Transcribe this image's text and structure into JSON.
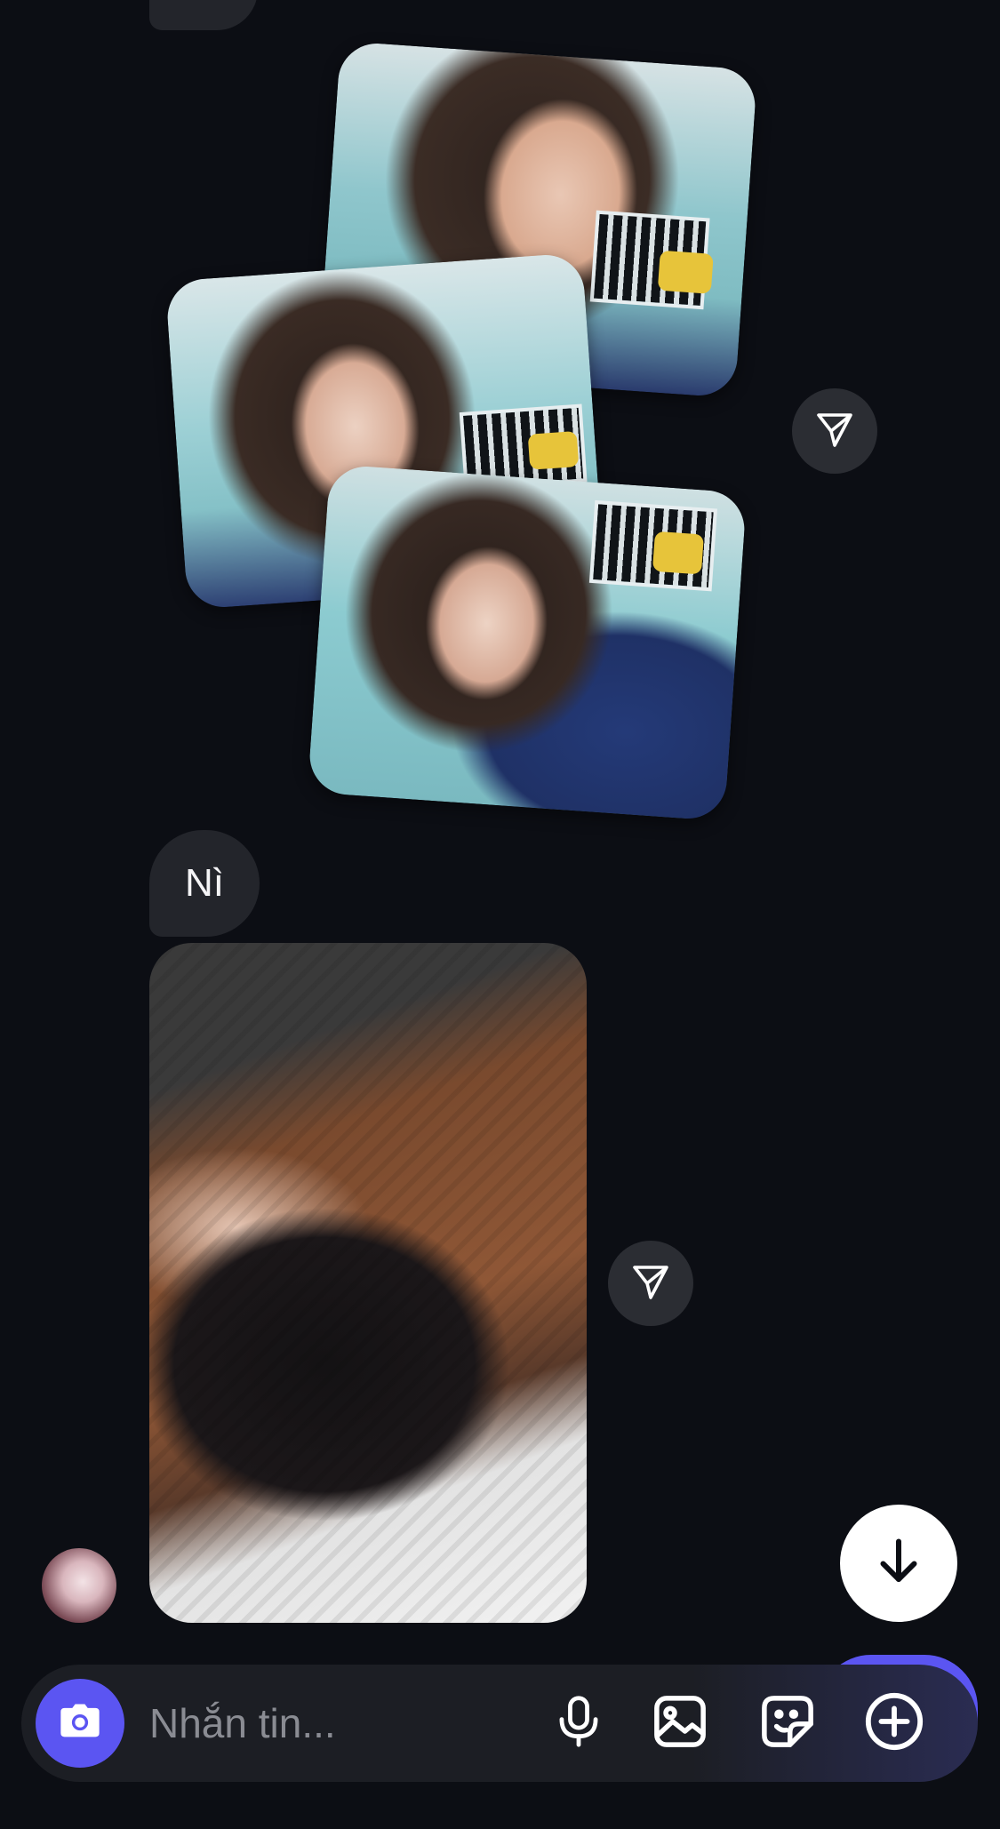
{
  "conversation": {
    "messages": [
      {
        "type": "image-group",
        "images": 3
      },
      {
        "type": "text",
        "text": "Nì"
      },
      {
        "type": "image",
        "images": 1
      }
    ]
  },
  "composer": {
    "placeholder": "Nhắn tin...",
    "camera_icon": "camera-icon",
    "mic_icon": "microphone-icon",
    "gallery_icon": "image-icon",
    "sticker_icon": "sticker-icon",
    "more_icon": "plus-circle-icon"
  },
  "actions": {
    "share_icon": "send-icon",
    "scroll_icon": "arrow-down-icon"
  },
  "colors": {
    "background": "#0c0e14",
    "bubble": "#23252b",
    "accent": "#5b55f2"
  }
}
